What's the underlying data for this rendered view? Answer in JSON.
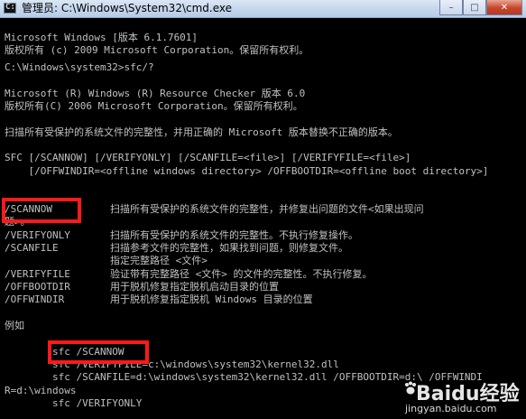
{
  "window": {
    "title": "管理员: C:\\Windows\\System32\\cmd.exe",
    "controls": {
      "minimize": "–",
      "maximize": "□",
      "close": "✕"
    }
  },
  "console": {
    "lines": [
      "Microsoft Windows [版本 6.1.7601]",
      "版权所有 (c) 2009 Microsoft Corporation。保留所有权利。",
      "",
      "C:\\Windows\\system32>sfc/?",
      "",
      "Microsoft (R) Windows (R) Resource Checker 版本 6.0",
      "版权所有(C) 2006 Microsoft Corporation。保留所有权利。",
      "",
      "扫描所有受保护的系统文件的完整性，并用正确的 Microsoft 版本替换不正确的版本。",
      "",
      "SFC [/SCANNOW] [/VERIFYONLY] [/SCANFILE=<file>] [/VERIFYFILE=<file>]",
      "    [/OFFWINDIR=<offline windows directory> /OFFBOOTDIR=<offline boot directory>]"
    ],
    "options": [
      {
        "name": "/SCANNOW",
        "desc": "扫描所有受保护的系统文件的完整性，并修复出问题的文件<如果出现问"
      },
      {
        "name": "题>。",
        "desc": ""
      },
      {
        "name": "/VERIFYONLY",
        "desc": "扫描所有受保护的系统文件的完整性。不执行修复操作。"
      },
      {
        "name": "/SCANFILE",
        "desc": "扫描参考文件的完整性，如果找到问题，则修复文件。"
      },
      {
        "name": "",
        "desc": "指定完整路径 <文件>"
      },
      {
        "name": "/VERIFYFILE",
        "desc": "验证带有完整路径 <文件> 的文件的完整性。不执行修复。"
      },
      {
        "name": "/OFFBOOTDIR",
        "desc": "用于脱机修复指定脱机启动目录的位置"
      },
      {
        "name": "/OFFWINDIR",
        "desc": "用于脱机修复指定脱机 Windows 目录的位置"
      }
    ],
    "example_heading": "例如",
    "examples": [
      "        sfc /SCANNOW",
      "        sfc /VERIFYFILE=c:\\windows\\system32\\kernel32.dll",
      "        sfc /SCANFILE=d:\\windows\\system32\\kernel32.dll /OFFBOOTDIR=d:\\ /OFFWINDI",
      "R=d:\\windows",
      "        sfc /VERIFYONLY"
    ]
  },
  "watermark": {
    "brand": "Baidu经验",
    "url": "jingyan.baidu.com"
  },
  "colors": {
    "console_bg": "#000000",
    "console_text": "#c0c0c0",
    "highlight": "#ff1a1a"
  }
}
